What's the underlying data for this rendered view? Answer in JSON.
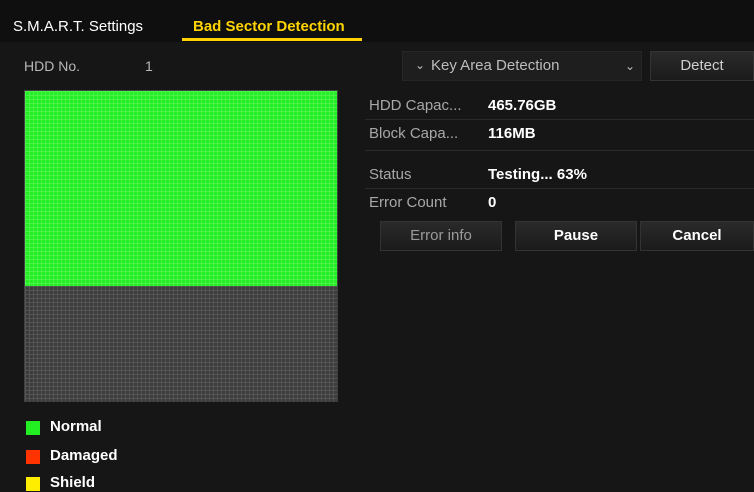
{
  "tabs": [
    {
      "label": "S.M.A.R.T. Settings",
      "active": false
    },
    {
      "label": "Bad Sector Detection",
      "active": true
    }
  ],
  "colors": {
    "accent": "#ffd400",
    "normal": "#22ee22",
    "damaged": "#ff3300",
    "shield": "#ffee00",
    "pending": "#3c3c3c"
  },
  "detect": {
    "hdd_label": "HDD No.",
    "hdd_value": "1",
    "mode": "Key Area Detection",
    "detect_button": "Detect"
  },
  "info": {
    "capacity_label": "HDD Capac...",
    "capacity_value": "465.76GB",
    "block_label": "Block Capa...",
    "block_value": "116MB",
    "status_label": "Status",
    "status_value": "Testing... 63%",
    "status_progress": 0.63,
    "error_label": "Error Count",
    "error_value": "0"
  },
  "buttons": {
    "error_info": "Error info",
    "pause": "Pause",
    "cancel": "Cancel"
  },
  "legend": [
    {
      "label": "Normal",
      "color": "#22ee22"
    },
    {
      "label": "Damaged",
      "color": "#ff3300"
    },
    {
      "label": "Shield",
      "color": "#ffee00"
    }
  ]
}
